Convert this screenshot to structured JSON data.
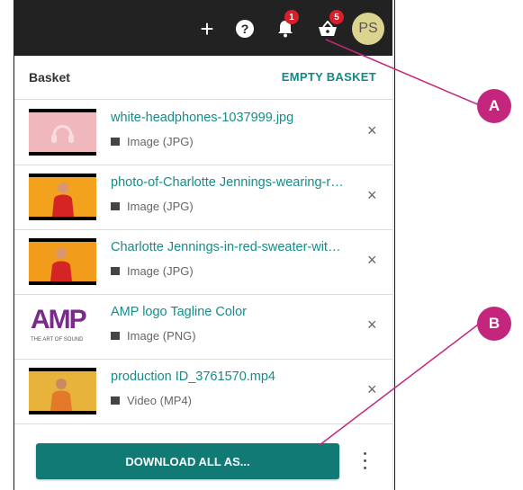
{
  "topbar": {
    "notifications_count": "1",
    "basket_count": "5",
    "avatar_initials": "PS"
  },
  "basket": {
    "title": "Basket",
    "empty_label": "EMPTY BASKET",
    "items": [
      {
        "name": "white-headphones-1037999.jpg",
        "type": "Image (JPG)",
        "type_icon": "image-icon"
      },
      {
        "name": "photo-of-Charlotte Jennings-wearing-red-sweater.jpg",
        "type": "Image (JPG)",
        "type_icon": "image-icon"
      },
      {
        "name": "Charlotte Jennings-in-red-sweater-with-yellow-background.jpg",
        "type": "Image (JPG)",
        "type_icon": "image-icon"
      },
      {
        "name": "AMP logo Tagline Color",
        "type": "Image (PNG)",
        "type_icon": "image-icon",
        "thumb_text": "AMP",
        "thumb_tagline": "THE ART OF SOUND"
      },
      {
        "name": "production ID_3761570.mp4",
        "type": "Video (MP4)",
        "type_icon": "video-icon"
      }
    ],
    "download_label": "DOWNLOAD ALL AS..."
  },
  "callouts": {
    "a": "A",
    "b": "B"
  },
  "colors": {
    "accent": "#117a75",
    "link": "#168c8a",
    "badge": "#d9202a",
    "callout": "#c4267d",
    "avatar": "#dad48f"
  }
}
